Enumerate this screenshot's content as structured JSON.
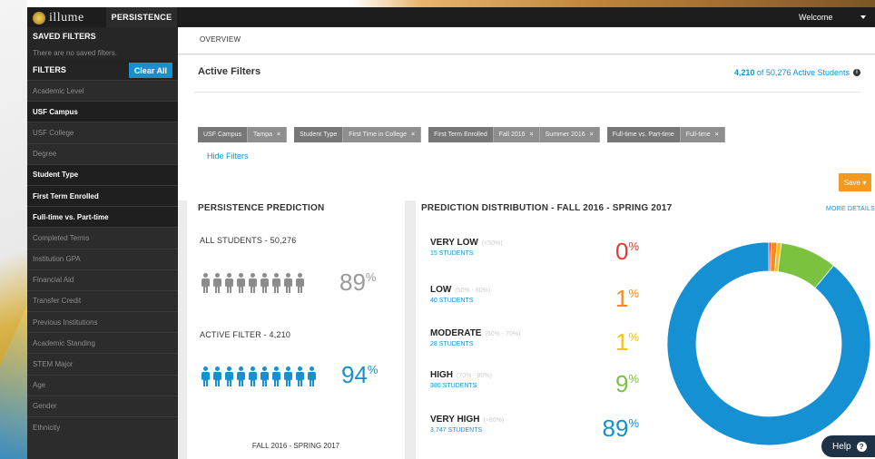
{
  "header": {
    "logo_text": "illume",
    "app_tab": "PERSISTENCE",
    "welcome": "Welcome"
  },
  "sidebar": {
    "saved_filters_title": "SAVED FILTERS",
    "saved_filters_note": "There are no saved filters.",
    "filters_title": "FILTERS",
    "clear_all": "Clear All",
    "items": [
      {
        "label": "Academic Level",
        "active": false
      },
      {
        "label": "USF Campus",
        "active": true
      },
      {
        "label": "USF College",
        "active": false
      },
      {
        "label": "Degree",
        "active": false
      },
      {
        "label": "Student Type",
        "active": true
      },
      {
        "label": "First Term Enrolled",
        "active": true
      },
      {
        "label": "Full-time vs. Part-time",
        "active": true
      },
      {
        "label": "Completed Terms",
        "active": false
      },
      {
        "label": "Institution GPA",
        "active": false
      },
      {
        "label": "Financial Aid",
        "active": false
      },
      {
        "label": "Transfer Credit",
        "active": false
      },
      {
        "label": "Previous Institutions",
        "active": false
      },
      {
        "label": "Academic Standing",
        "active": false
      },
      {
        "label": "STEM Major",
        "active": false
      },
      {
        "label": "Age",
        "active": false
      },
      {
        "label": "Gender",
        "active": false
      },
      {
        "label": "Ethnicity",
        "active": false
      }
    ]
  },
  "overview": {
    "tab": "OVERVIEW",
    "active_filters_title": "Active Filters",
    "active_count": "4,210",
    "active_count_suffix": "of 50,276 Active Students",
    "hide_filters": "Hide Filters",
    "save_label": "Save ▾",
    "chips": [
      {
        "label": "USF Campus",
        "values": [
          "Tampa"
        ]
      },
      {
        "label": "Student Type",
        "values": [
          "First Time in College"
        ]
      },
      {
        "label": "First Term Enrolled",
        "values": [
          "Fall 2016",
          "Summer 2016"
        ]
      },
      {
        "label": "Full-time vs. Part-time",
        "values": [
          "Full-time"
        ]
      }
    ]
  },
  "persistence": {
    "title": "PERSISTENCE PREDICTION",
    "all_students_label": "ALL STUDENTS - 50,276",
    "all_students_pct": "89",
    "active_filter_label": "ACTIVE FILTER - 4,210",
    "active_filter_pct": "94",
    "footer": "FALL 2016 - SPRING 2017",
    "pct_sign": "%"
  },
  "distribution": {
    "title": "PREDICTION DISTRIBUTION - FALL 2016 - SPRING 2017",
    "more_details": "MORE DETAILS",
    "rows": [
      {
        "label": "VERY LOW",
        "range": "(<50%)",
        "students": "15 STUDENTS",
        "pct": "0",
        "color": "#e53935"
      },
      {
        "label": "LOW",
        "range": "(50% - 60%)",
        "students": "40 STUDENTS",
        "pct": "1",
        "color": "#f38b1e"
      },
      {
        "label": "MODERATE",
        "range": "(60% - 70%)",
        "students": "28 STUDENTS",
        "pct": "1",
        "color": "#f2c21b"
      },
      {
        "label": "HIGH",
        "range": "(70% - 80%)",
        "students": "380 STUDENTS",
        "pct": "9",
        "color": "#7cc241"
      },
      {
        "label": "VERY HIGH",
        "range": "(>80%)",
        "students": "3,747 STUDENTS",
        "pct": "89",
        "color": "#1590d2"
      }
    ],
    "donut_shares": [
      0.36,
      0.95,
      0.67,
      9.03,
      88.99
    ]
  },
  "help": {
    "label": "Help",
    "icon": "?"
  }
}
